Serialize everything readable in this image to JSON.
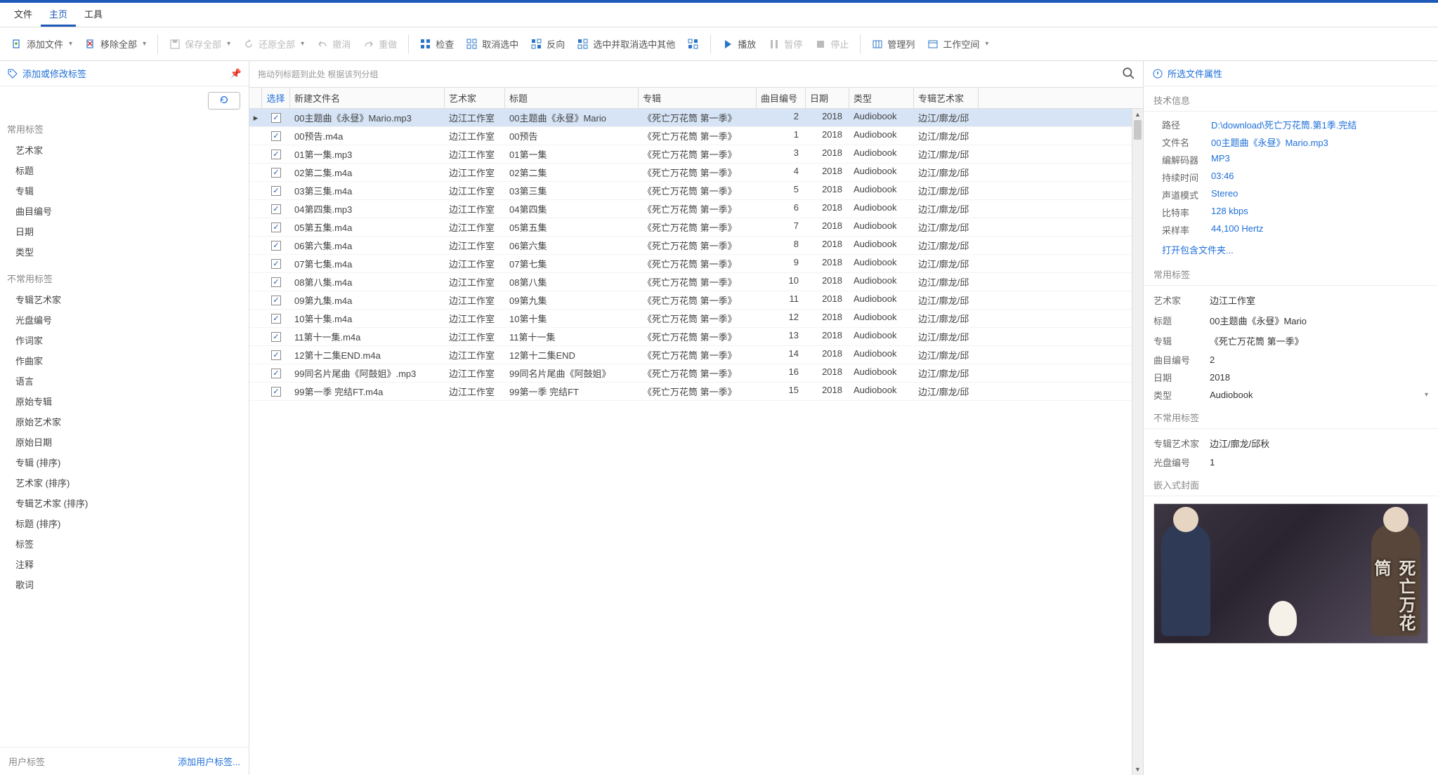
{
  "menu": {
    "file": "文件",
    "home": "主页",
    "tools": "工具"
  },
  "toolbar": {
    "add_file": "添加文件",
    "remove_all": "移除全部",
    "save_all": "保存全部",
    "restore_all": "还原全部",
    "undo": "撤消",
    "redo": "重做",
    "check": "检查",
    "deselect": "取消选中",
    "invert": "反向",
    "select_deselect_others": "选中并取消选中其他",
    "play": "播放",
    "pause": "暂停",
    "stop": "停止",
    "manage_cols": "管理列",
    "workspace": "工作空间"
  },
  "left": {
    "header": "添加或修改标签",
    "common_title": "常用标签",
    "common": [
      "艺术家",
      "标题",
      "专辑",
      "曲目编号",
      "日期",
      "类型"
    ],
    "uncommon_title": "不常用标签",
    "uncommon": [
      "专辑艺术家",
      "光盘编号",
      "作词家",
      "作曲家",
      "语言",
      "原始专辑",
      "原始艺术家",
      "原始日期",
      "专辑 (排序)",
      "艺术家 (排序)",
      "专辑艺术家 (排序)",
      "标题 (排序)",
      "标签",
      "注释",
      "歌词"
    ],
    "user_tags": "用户标签",
    "add_user_tag": "添加用户标签..."
  },
  "grid": {
    "group_hint": "拖动列标题到此处 根据该列分组",
    "headers": {
      "select": "选择",
      "filename": "新建文件名",
      "artist": "艺术家",
      "title": "标题",
      "album": "专辑",
      "track": "曲目编号",
      "date": "日期",
      "type": "类型",
      "album_artist": "专辑艺术家"
    },
    "rows": [
      {
        "sel": true,
        "filename": "00主题曲《永昼》Mario.mp3",
        "artist": "边江工作室",
        "title": "00主题曲《永昼》Mario",
        "album": "《死亡万花筒 第一季》",
        "track": 2,
        "date": 2018,
        "type": "Audiobook",
        "aartist": "边江/廓龙/邱"
      },
      {
        "sel": true,
        "filename": "00预告.m4a",
        "artist": "边江工作室",
        "title": "00预告",
        "album": "《死亡万花筒 第一季》",
        "track": 1,
        "date": 2018,
        "type": "Audiobook",
        "aartist": "边江/廓龙/邱"
      },
      {
        "sel": true,
        "filename": "01第一集.mp3",
        "artist": "边江工作室",
        "title": "01第一集",
        "album": "《死亡万花筒 第一季》",
        "track": 3,
        "date": 2018,
        "type": "Audiobook",
        "aartist": "边江/廓龙/邱"
      },
      {
        "sel": true,
        "filename": "02第二集.m4a",
        "artist": "边江工作室",
        "title": "02第二集",
        "album": "《死亡万花筒 第一季》",
        "track": 4,
        "date": 2018,
        "type": "Audiobook",
        "aartist": "边江/廓龙/邱"
      },
      {
        "sel": true,
        "filename": "03第三集.m4a",
        "artist": "边江工作室",
        "title": "03第三集",
        "album": "《死亡万花筒 第一季》",
        "track": 5,
        "date": 2018,
        "type": "Audiobook",
        "aartist": "边江/廓龙/邱"
      },
      {
        "sel": true,
        "filename": "04第四集.mp3",
        "artist": "边江工作室",
        "title": "04第四集",
        "album": "《死亡万花筒 第一季》",
        "track": 6,
        "date": 2018,
        "type": "Audiobook",
        "aartist": "边江/廓龙/邱"
      },
      {
        "sel": true,
        "filename": "05第五集.m4a",
        "artist": "边江工作室",
        "title": "05第五集",
        "album": "《死亡万花筒 第一季》",
        "track": 7,
        "date": 2018,
        "type": "Audiobook",
        "aartist": "边江/廓龙/邱"
      },
      {
        "sel": true,
        "filename": "06第六集.m4a",
        "artist": "边江工作室",
        "title": "06第六集",
        "album": "《死亡万花筒 第一季》",
        "track": 8,
        "date": 2018,
        "type": "Audiobook",
        "aartist": "边江/廓龙/邱"
      },
      {
        "sel": true,
        "filename": "07第七集.m4a",
        "artist": "边江工作室",
        "title": "07第七集",
        "album": "《死亡万花筒 第一季》",
        "track": 9,
        "date": 2018,
        "type": "Audiobook",
        "aartist": "边江/廓龙/邱"
      },
      {
        "sel": true,
        "filename": "08第八集.m4a",
        "artist": "边江工作室",
        "title": "08第八集",
        "album": "《死亡万花筒 第一季》",
        "track": 10,
        "date": 2018,
        "type": "Audiobook",
        "aartist": "边江/廓龙/邱"
      },
      {
        "sel": true,
        "filename": "09第九集.m4a",
        "artist": "边江工作室",
        "title": "09第九集",
        "album": "《死亡万花筒 第一季》",
        "track": 11,
        "date": 2018,
        "type": "Audiobook",
        "aartist": "边江/廓龙/邱"
      },
      {
        "sel": true,
        "filename": "10第十集.m4a",
        "artist": "边江工作室",
        "title": "10第十集",
        "album": "《死亡万花筒 第一季》",
        "track": 12,
        "date": 2018,
        "type": "Audiobook",
        "aartist": "边江/廓龙/邱"
      },
      {
        "sel": true,
        "filename": "11第十一集.m4a",
        "artist": "边江工作室",
        "title": "11第十一集",
        "album": "《死亡万花筒 第一季》",
        "track": 13,
        "date": 2018,
        "type": "Audiobook",
        "aartist": "边江/廓龙/邱"
      },
      {
        "sel": true,
        "filename": "12第十二集END.m4a",
        "artist": "边江工作室",
        "title": "12第十二集END",
        "album": "《死亡万花筒 第一季》",
        "track": 14,
        "date": 2018,
        "type": "Audiobook",
        "aartist": "边江/廓龙/邱"
      },
      {
        "sel": true,
        "filename": "99同名片尾曲《阿鼓姐》.mp3",
        "artist": "边江工作室",
        "title": "99同名片尾曲《阿鼓姐》",
        "album": "《死亡万花筒 第一季》",
        "track": 16,
        "date": 2018,
        "type": "Audiobook",
        "aartist": "边江/廓龙/邱"
      },
      {
        "sel": true,
        "filename": "99第一季 完结FT.m4a",
        "artist": "边江工作室",
        "title": "99第一季 完结FT",
        "album": "《死亡万花筒 第一季》",
        "track": 15,
        "date": 2018,
        "type": "Audiobook",
        "aartist": "边江/廓龙/邱"
      }
    ]
  },
  "right": {
    "header": "所选文件属性",
    "tech_title": "技术信息",
    "tech": {
      "path_k": "路径",
      "path_v": "D:\\download\\死亡万花筒.第1季.完结",
      "filename_k": "文件名",
      "filename_v": "00主题曲《永昼》Mario.mp3",
      "codec_k": "编解码器",
      "codec_v": "MP3",
      "duration_k": "持续时间",
      "duration_v": "03:46",
      "channels_k": "声道模式",
      "channels_v": "Stereo",
      "bitrate_k": "比特率",
      "bitrate_v": "128 kbps",
      "sample_k": "采样率",
      "sample_v": "44,100 Hertz",
      "open_folder": "打开包含文件夹..."
    },
    "common_title": "常用标签",
    "fields": {
      "artist_k": "艺术家",
      "artist_v": "边江工作室",
      "title_k": "标题",
      "title_v": "00主题曲《永昼》Mario",
      "album_k": "专辑",
      "album_v": "《死亡万花筒 第一季》",
      "track_k": "曲目编号",
      "track_v": "2",
      "date_k": "日期",
      "date_v": "2018",
      "type_k": "类型",
      "type_v": "Audiobook"
    },
    "uncommon_title": "不常用标签",
    "ufields": {
      "aartist_k": "专辑艺术家",
      "aartist_v": "边江/廓龙/邱秋",
      "disc_k": "光盘编号",
      "disc_v": "1"
    },
    "cover_title": "嵌入式封面",
    "cover_text": "死亡万花筒"
  }
}
